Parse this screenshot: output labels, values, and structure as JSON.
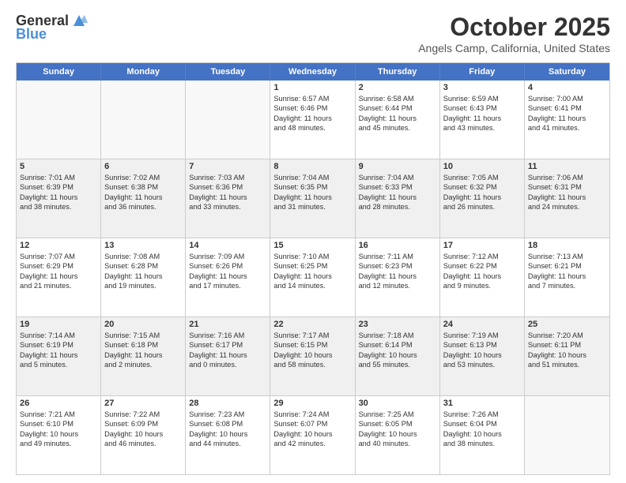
{
  "header": {
    "logo_general": "General",
    "logo_blue": "Blue",
    "month": "October 2025",
    "location": "Angels Camp, California, United States"
  },
  "weekdays": [
    "Sunday",
    "Monday",
    "Tuesday",
    "Wednesday",
    "Thursday",
    "Friday",
    "Saturday"
  ],
  "rows": [
    [
      {
        "day": "",
        "text": "",
        "empty": true
      },
      {
        "day": "",
        "text": "",
        "empty": true
      },
      {
        "day": "",
        "text": "",
        "empty": true
      },
      {
        "day": "1",
        "text": "Sunrise: 6:57 AM\nSunset: 6:46 PM\nDaylight: 11 hours\nand 48 minutes.",
        "empty": false
      },
      {
        "day": "2",
        "text": "Sunrise: 6:58 AM\nSunset: 6:44 PM\nDaylight: 11 hours\nand 45 minutes.",
        "empty": false
      },
      {
        "day": "3",
        "text": "Sunrise: 6:59 AM\nSunset: 6:43 PM\nDaylight: 11 hours\nand 43 minutes.",
        "empty": false
      },
      {
        "day": "4",
        "text": "Sunrise: 7:00 AM\nSunset: 6:41 PM\nDaylight: 11 hours\nand 41 minutes.",
        "empty": false
      }
    ],
    [
      {
        "day": "5",
        "text": "Sunrise: 7:01 AM\nSunset: 6:39 PM\nDaylight: 11 hours\nand 38 minutes.",
        "empty": false,
        "shaded": true
      },
      {
        "day": "6",
        "text": "Sunrise: 7:02 AM\nSunset: 6:38 PM\nDaylight: 11 hours\nand 36 minutes.",
        "empty": false,
        "shaded": true
      },
      {
        "day": "7",
        "text": "Sunrise: 7:03 AM\nSunset: 6:36 PM\nDaylight: 11 hours\nand 33 minutes.",
        "empty": false,
        "shaded": true
      },
      {
        "day": "8",
        "text": "Sunrise: 7:04 AM\nSunset: 6:35 PM\nDaylight: 11 hours\nand 31 minutes.",
        "empty": false,
        "shaded": true
      },
      {
        "day": "9",
        "text": "Sunrise: 7:04 AM\nSunset: 6:33 PM\nDaylight: 11 hours\nand 28 minutes.",
        "empty": false,
        "shaded": true
      },
      {
        "day": "10",
        "text": "Sunrise: 7:05 AM\nSunset: 6:32 PM\nDaylight: 11 hours\nand 26 minutes.",
        "empty": false,
        "shaded": true
      },
      {
        "day": "11",
        "text": "Sunrise: 7:06 AM\nSunset: 6:31 PM\nDaylight: 11 hours\nand 24 minutes.",
        "empty": false,
        "shaded": true
      }
    ],
    [
      {
        "day": "12",
        "text": "Sunrise: 7:07 AM\nSunset: 6:29 PM\nDaylight: 11 hours\nand 21 minutes.",
        "empty": false
      },
      {
        "day": "13",
        "text": "Sunrise: 7:08 AM\nSunset: 6:28 PM\nDaylight: 11 hours\nand 19 minutes.",
        "empty": false
      },
      {
        "day": "14",
        "text": "Sunrise: 7:09 AM\nSunset: 6:26 PM\nDaylight: 11 hours\nand 17 minutes.",
        "empty": false
      },
      {
        "day": "15",
        "text": "Sunrise: 7:10 AM\nSunset: 6:25 PM\nDaylight: 11 hours\nand 14 minutes.",
        "empty": false
      },
      {
        "day": "16",
        "text": "Sunrise: 7:11 AM\nSunset: 6:23 PM\nDaylight: 11 hours\nand 12 minutes.",
        "empty": false
      },
      {
        "day": "17",
        "text": "Sunrise: 7:12 AM\nSunset: 6:22 PM\nDaylight: 11 hours\nand 9 minutes.",
        "empty": false
      },
      {
        "day": "18",
        "text": "Sunrise: 7:13 AM\nSunset: 6:21 PM\nDaylight: 11 hours\nand 7 minutes.",
        "empty": false
      }
    ],
    [
      {
        "day": "19",
        "text": "Sunrise: 7:14 AM\nSunset: 6:19 PM\nDaylight: 11 hours\nand 5 minutes.",
        "empty": false,
        "shaded": true
      },
      {
        "day": "20",
        "text": "Sunrise: 7:15 AM\nSunset: 6:18 PM\nDaylight: 11 hours\nand 2 minutes.",
        "empty": false,
        "shaded": true
      },
      {
        "day": "21",
        "text": "Sunrise: 7:16 AM\nSunset: 6:17 PM\nDaylight: 11 hours\nand 0 minutes.",
        "empty": false,
        "shaded": true
      },
      {
        "day": "22",
        "text": "Sunrise: 7:17 AM\nSunset: 6:15 PM\nDaylight: 10 hours\nand 58 minutes.",
        "empty": false,
        "shaded": true
      },
      {
        "day": "23",
        "text": "Sunrise: 7:18 AM\nSunset: 6:14 PM\nDaylight: 10 hours\nand 55 minutes.",
        "empty": false,
        "shaded": true
      },
      {
        "day": "24",
        "text": "Sunrise: 7:19 AM\nSunset: 6:13 PM\nDaylight: 10 hours\nand 53 minutes.",
        "empty": false,
        "shaded": true
      },
      {
        "day": "25",
        "text": "Sunrise: 7:20 AM\nSunset: 6:11 PM\nDaylight: 10 hours\nand 51 minutes.",
        "empty": false,
        "shaded": true
      }
    ],
    [
      {
        "day": "26",
        "text": "Sunrise: 7:21 AM\nSunset: 6:10 PM\nDaylight: 10 hours\nand 49 minutes.",
        "empty": false
      },
      {
        "day": "27",
        "text": "Sunrise: 7:22 AM\nSunset: 6:09 PM\nDaylight: 10 hours\nand 46 minutes.",
        "empty": false
      },
      {
        "day": "28",
        "text": "Sunrise: 7:23 AM\nSunset: 6:08 PM\nDaylight: 10 hours\nand 44 minutes.",
        "empty": false
      },
      {
        "day": "29",
        "text": "Sunrise: 7:24 AM\nSunset: 6:07 PM\nDaylight: 10 hours\nand 42 minutes.",
        "empty": false
      },
      {
        "day": "30",
        "text": "Sunrise: 7:25 AM\nSunset: 6:05 PM\nDaylight: 10 hours\nand 40 minutes.",
        "empty": false
      },
      {
        "day": "31",
        "text": "Sunrise: 7:26 AM\nSunset: 6:04 PM\nDaylight: 10 hours\nand 38 minutes.",
        "empty": false
      },
      {
        "day": "",
        "text": "",
        "empty": true
      }
    ]
  ]
}
